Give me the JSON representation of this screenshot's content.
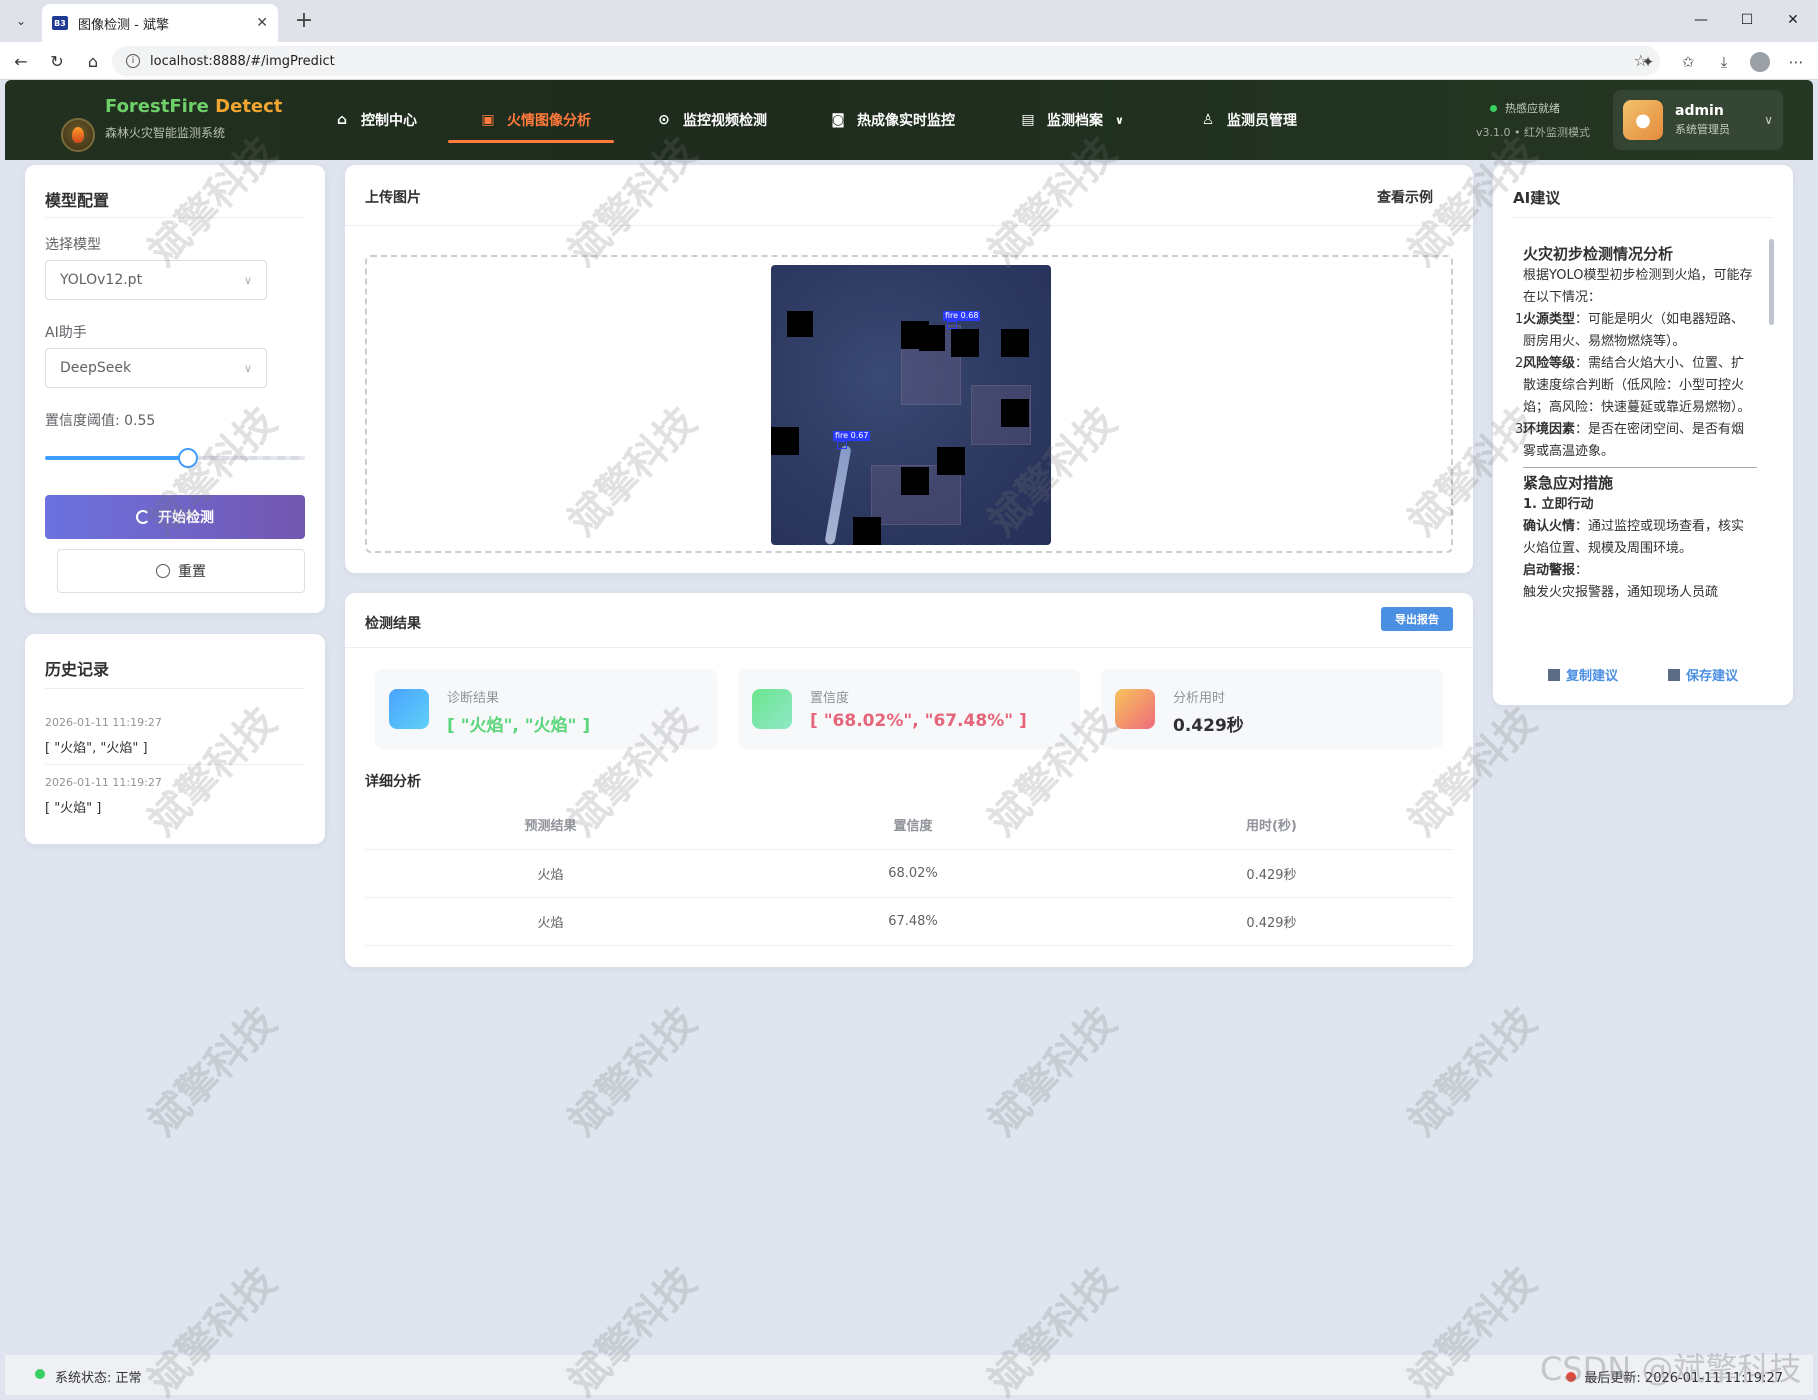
{
  "browser": {
    "tab_title": "图像检测 - 斌擎",
    "url": "localhost:8888/#/imgPredict"
  },
  "header": {
    "brand_part1": "ForestFire",
    "brand_part2": "Detect",
    "subtitle": "森林火灾智能监测系统",
    "nav": [
      {
        "label": "控制中心",
        "icon": "home-icon"
      },
      {
        "label": "火情图像分析",
        "icon": "image-icon",
        "active": true
      },
      {
        "label": "监控视频检测",
        "icon": "play-icon"
      },
      {
        "label": "热成像实时监控",
        "icon": "camera-icon"
      },
      {
        "label": "监测档案",
        "icon": "document-icon"
      },
      {
        "label": "监测员管理",
        "icon": "user-icon"
      }
    ],
    "sensor_status": "热感应就绪",
    "version": "v3.1.0 • 红外监测模式",
    "user": {
      "name": "admin",
      "role": "系统管理员"
    }
  },
  "config": {
    "title": "模型配置",
    "model_label": "选择模型",
    "model_value": "YOLOv12.pt",
    "assistant_label": "AI助手",
    "assistant_value": "DeepSeek",
    "threshold_label": "置信度阈值: 0.55",
    "threshold_value": 0.55,
    "start_label": "开始检测",
    "reset_label": "重置"
  },
  "history": {
    "title": "历史记录",
    "items": [
      {
        "time": "2026-01-11 11:19:27",
        "value": "[ \"火焰\", \"火焰\" ]"
      },
      {
        "time": "2026-01-11 11:19:27",
        "value": "[ \"火焰\" ]"
      }
    ]
  },
  "upload": {
    "title": "上传图片",
    "sample_label": "查看示例",
    "detections": [
      {
        "label": "fire 0.68"
      },
      {
        "label": "fire 0.67"
      }
    ]
  },
  "results": {
    "title": "检测结果",
    "export_label": "导出报告",
    "cards": [
      {
        "label": "诊断结果",
        "value": "[ \"火焰\", \"火焰\" ]",
        "color": "#5bd67a"
      },
      {
        "label": "置信度",
        "value": "[ \"68.02%\", \"67.48%\" ]",
        "color": "#e5657a"
      },
      {
        "label": "分析用时",
        "value": "0.429秒",
        "color": "#303133"
      }
    ],
    "detail_title": "详细分析",
    "columns": [
      "预测结果",
      "置信度",
      "用时(秒)"
    ],
    "rows": [
      [
        "火焰",
        "68.02%",
        "0.429秒"
      ],
      [
        "火焰",
        "67.48%",
        "0.429秒"
      ]
    ]
  },
  "ai": {
    "title": "AI建议",
    "h1": "火灾初步检测情况分析",
    "intro": "根据YOLO模型初步检测到火焰，可能存在以下情况：",
    "points": [
      {
        "n": "1.",
        "k": "火源类型",
        "v": "：可能是明火（如电器短路、厨房用火、易燃物燃烧等）。"
      },
      {
        "n": "2.",
        "k": "风险等级",
        "v": "：需结合火焰大小、位置、扩散速度综合判断（低风险：小型可控火焰；高风险：快速蔓延或靠近易燃物）。"
      },
      {
        "n": "3.",
        "k": "环境因素",
        "v": "：是否在密闭空间、是否有烟雾或高温迹象。"
      }
    ],
    "h2": "紧急应对措施",
    "h3": "1. 立即行动",
    "p1_k": "确认火情",
    "p1_v": "：通过监控或现场查看，核实火焰位置、规模及周围环境。",
    "p2_k": "启动警报",
    "p2_v": "：",
    "p3": "触发火灾报警器，通知现场人员疏",
    "copy_label": "复制建议",
    "save_label": "保存建议"
  },
  "status": {
    "left": "系统状态: 正常",
    "right": "最后更新: 2026-01-11 11:19:27"
  },
  "watermark": "斌擎科技",
  "csdn": "CSDN @斌擎科技"
}
